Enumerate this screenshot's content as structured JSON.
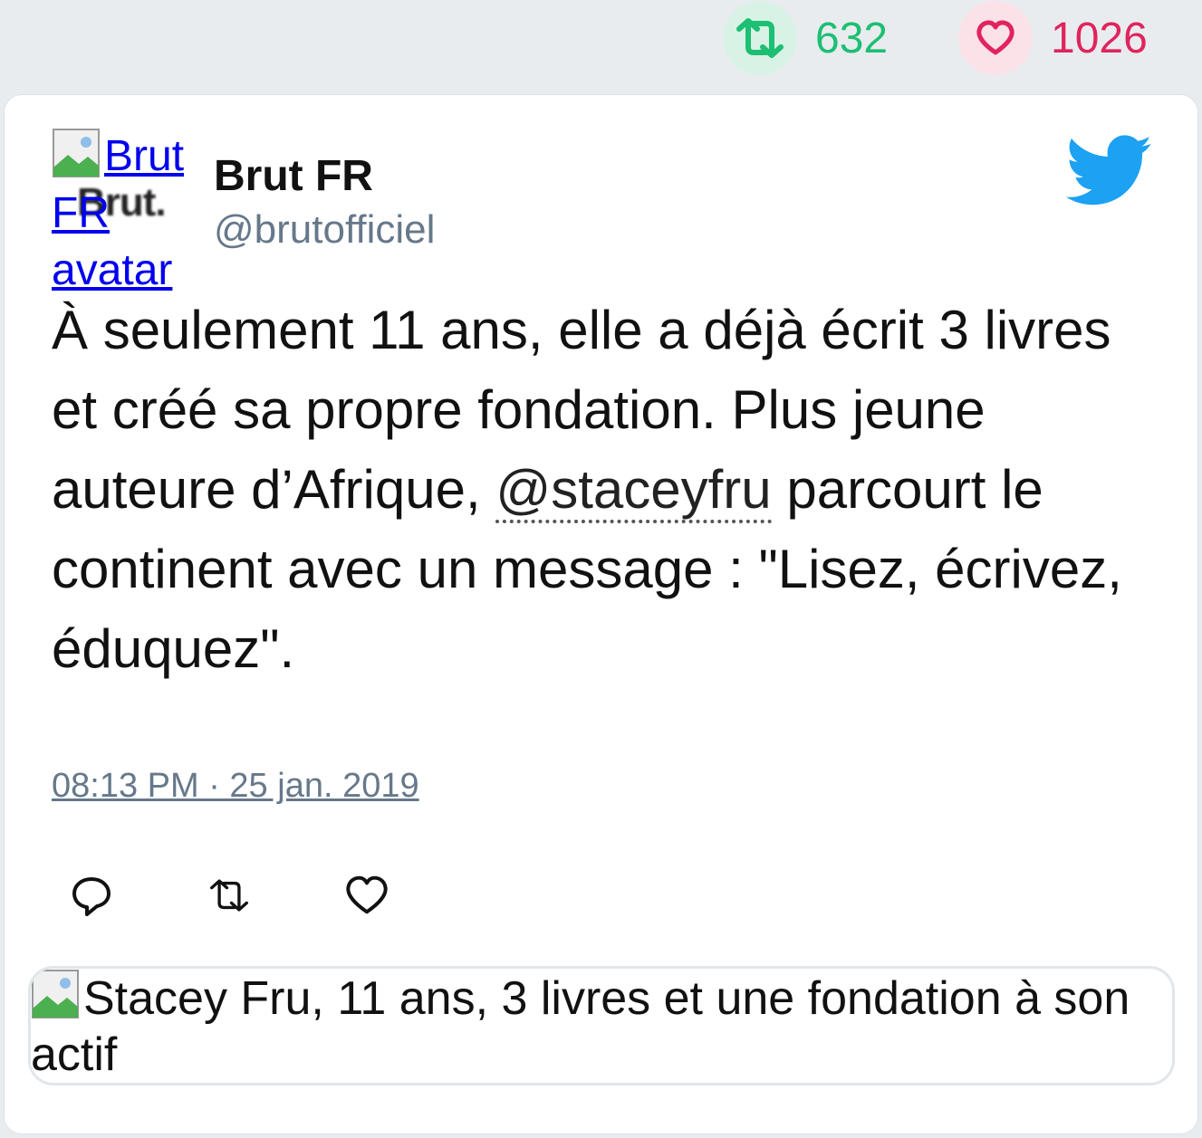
{
  "stats": {
    "retweet_icon": "retweet-icon",
    "retweet_count": "632",
    "like_icon": "heart-icon",
    "like_count": "1026",
    "retweet_color": "#1dbf73",
    "like_color": "#e0245e"
  },
  "tweet": {
    "avatar_alt_line1": "Brut",
    "avatar_alt_line2": "FR",
    "avatar_alt_line3": "avatar",
    "avatar_thumb_text": "Brut.",
    "author_name": "Brut FR",
    "author_handle": "@brutofficiel",
    "text_before": "À seulement 11 ans, elle a déjà écrit 3 livres et créé sa propre fondation. Plus jeune auteure d’Afrique, ",
    "mention": "@staceyfru",
    "text_after": " parcourt le continent avec un message : \"Lisez, écrivez, éduquez\".",
    "timestamp": "08:13 PM · 25 jan. 2019",
    "brand_color": "#1da1f2"
  },
  "actions": [
    "reply-icon",
    "retweet-icon",
    "like-icon"
  ],
  "link_card": {
    "image_alt": "Stacey Fru, 11 ans, 3 livres et une fondation à son actif"
  }
}
